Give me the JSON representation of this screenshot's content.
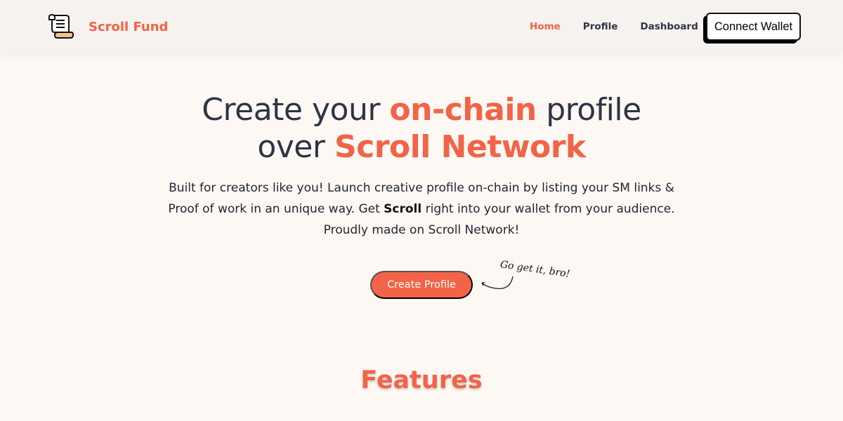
{
  "brand": {
    "name": "Scroll Fund",
    "logo_icon": "scroll-icon"
  },
  "nav": {
    "items": [
      {
        "label": "Home",
        "active": true
      },
      {
        "label": "Profile",
        "active": false
      },
      {
        "label": "Dashboard",
        "active": false
      }
    ],
    "connect_wallet": "Connect Wallet"
  },
  "hero": {
    "title_line1_part1": "Create your ",
    "title_line1_accent": "on-chain",
    "title_line1_part2": " profile",
    "title_line2_part1": "over ",
    "title_line2_accent": "Scroll Network",
    "desc_part1": "Built for creators like you! Launch creative profile on-chain by listing your SM links & Proof of work in an unique way. Get ",
    "desc_bold": "Scroll",
    "desc_part2": " right into your wallet from your audience.",
    "desc_line2": "Proudly made on Scroll Network!",
    "cta_label": "Create Profile",
    "note": "Go get it, bro!"
  },
  "features": {
    "title": "Features"
  },
  "colors": {
    "accent": "#f26347",
    "text": "#2e3445",
    "background": "#fdf8f4"
  }
}
